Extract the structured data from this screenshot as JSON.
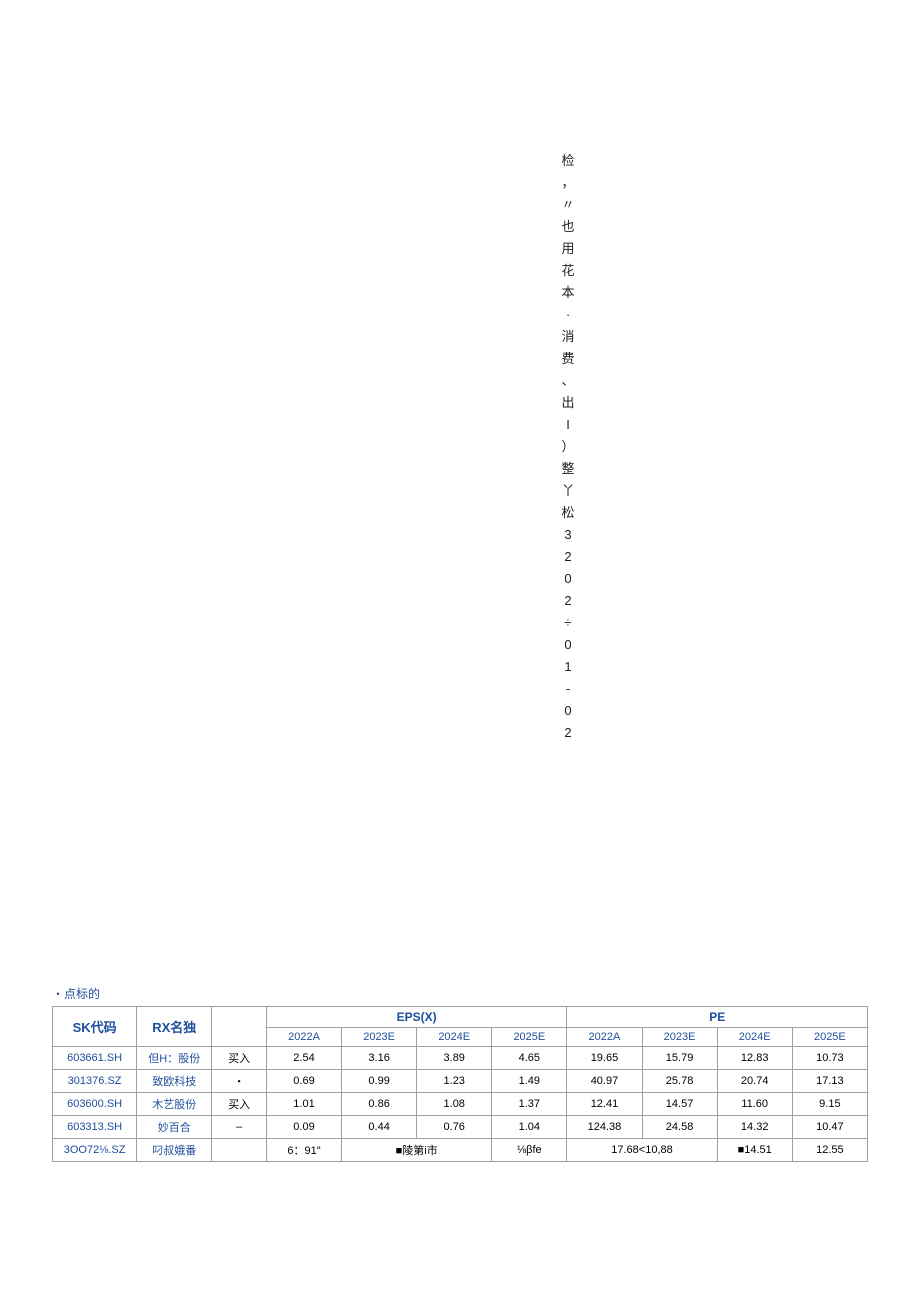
{
  "vertical_chars": [
    "检",
    "，",
    "〃",
    "也",
    "用",
    "花",
    "本",
    "·",
    "消",
    "费",
    "、",
    "出",
    "I",
    "）",
    "整",
    "丫",
    "松",
    "3",
    "2",
    "0",
    "2",
    "÷",
    "0",
    "1",
    "-",
    "0",
    "2"
  ],
  "caption": "・点标的",
  "headers": {
    "sk_prefix": "SK",
    "sk_suffix": "代码",
    "rx_prefix": "RX",
    "rx_suffix": "名独",
    "eps": "EPS(X)",
    "pe": "PE"
  },
  "years": [
    "2022A",
    "2023E",
    "2024E",
    "2025E"
  ],
  "rows": [
    {
      "code": "603661.SH",
      "name": "但H：股份",
      "rating": "买入",
      "eps": [
        "2.54",
        "3.16",
        "3.89",
        "4.65"
      ],
      "pe": [
        "19.65",
        "15.79",
        "12.83",
        "10.73"
      ]
    },
    {
      "code": "301376.SZ",
      "name": "致欧科技",
      "rating": "・",
      "eps": [
        "0.69",
        "0.99",
        "1.23",
        "1.49"
      ],
      "pe": [
        "40.97",
        "25.78",
        "20.74",
        "17.13"
      ]
    },
    {
      "code": "603600.SH",
      "name": "木艺股份",
      "rating": "买入",
      "eps": [
        "1.01",
        "0.86",
        "1.08",
        "1.37"
      ],
      "pe": [
        "12.41",
        "14.57",
        "11.60",
        "9.15"
      ]
    },
    {
      "code": "603313.SH",
      "name": "妙百合",
      "rating": "–",
      "eps": [
        "0.09",
        "0.44",
        "0.76",
        "1.04"
      ],
      "pe": [
        "124.38",
        "24.58",
        "14.32",
        "10.47"
      ]
    }
  ],
  "footer_row": {
    "code": "3OO72⅛.SZ",
    "name": "叼叔娥番",
    "rating": "",
    "c1": "6：91\"",
    "c2": "■陵第i市",
    "c3": "⅛βfe",
    "c4": "17.68<10,88",
    "c5": "■14.51",
    "c6": "12.55"
  }
}
